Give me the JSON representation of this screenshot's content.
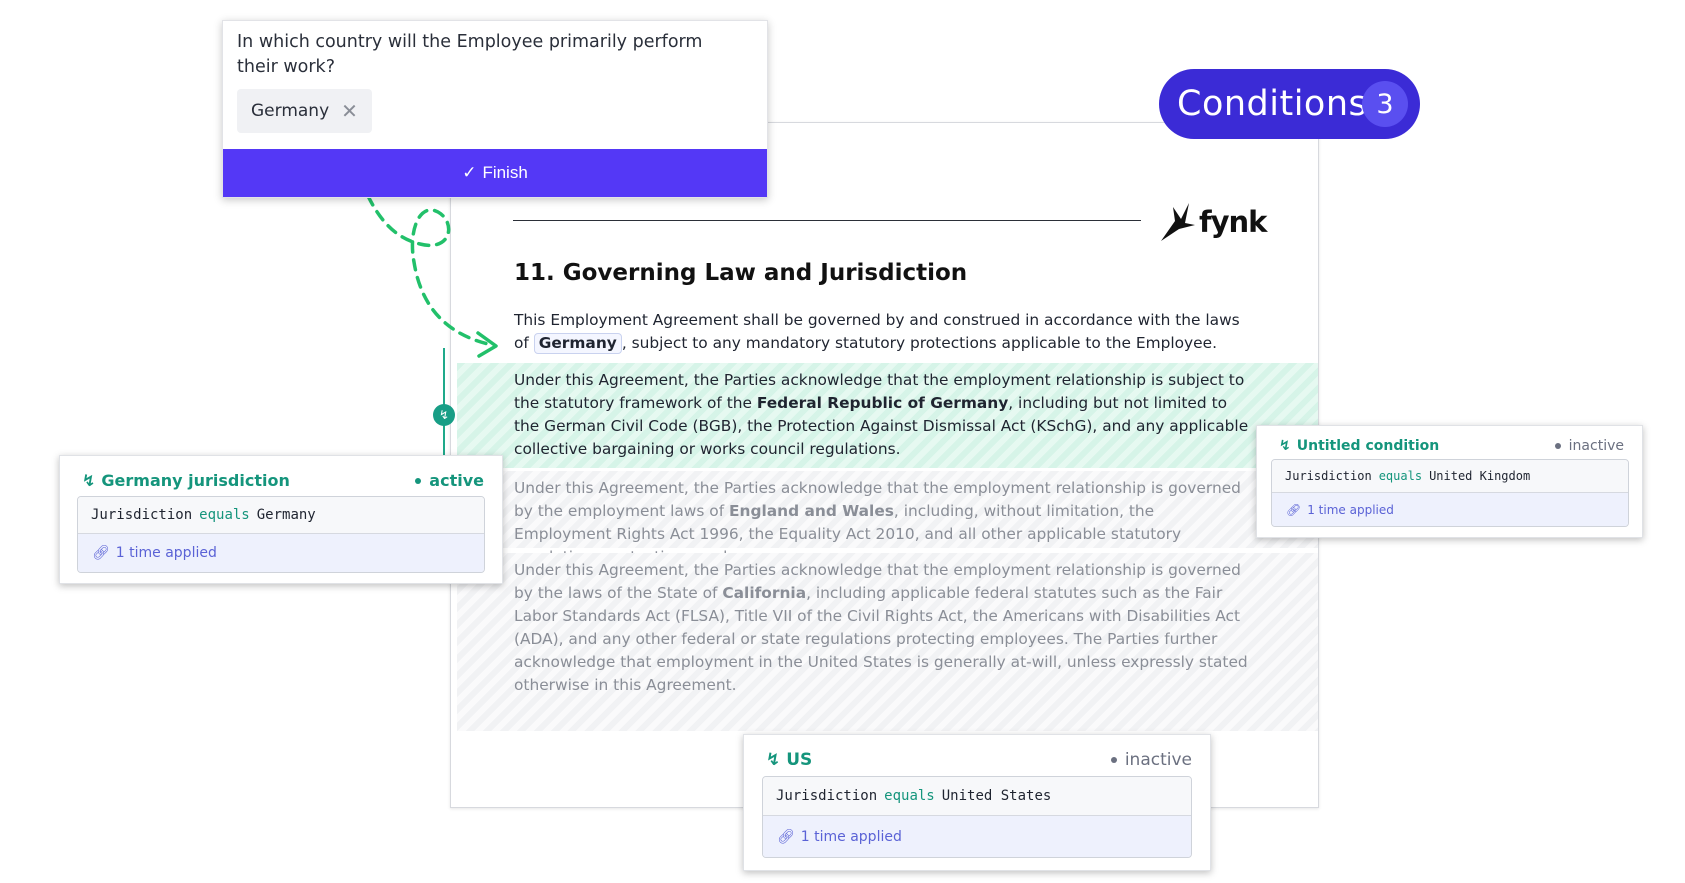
{
  "conditions": {
    "label": "Conditions",
    "count": "3"
  },
  "question": {
    "text": "In which country will the Employee primarily perform their work?",
    "selected_value": "Germany",
    "finish_label": "Finish"
  },
  "brand": {
    "logo_text": "fynk"
  },
  "document": {
    "heading": "11. Governing Law and Jurisdiction",
    "p1_before": "This Employment Agreement shall be governed by and construed in accordance with the laws of ",
    "p1_variable": "Germany",
    "p1_after": ", subject to any mandatory statutory protections applicable to the Employee.",
    "block_de": {
      "before": "Under this Agreement, the Parties acknowledge that the employment relationship is subject to the statutory framework of the ",
      "bold": "Federal Republic of Germany",
      "after": ", including but not limited to the German Civil Code (BGB), the Protection Against Dismissal Act (KSchG), and any applicable collective bargaining or works council regulations."
    },
    "block_ew": {
      "before": "Under this Agreement, the Parties acknowledge that the employment relationship is governed by the employment laws of ",
      "bold": "England and Wales",
      "after": ", including, without limitation, the Employment Rights Act 1996, the Equality Act 2010, and all other applicable statutory regulations protecting employees."
    },
    "block_ca": {
      "before": "Under this Agreement, the Parties acknowledge that the employment relationship is governed by the laws of the State of ",
      "bold": "California",
      "after": ", including applicable federal statutes such as the Fair Labor Standards Act (FLSA), Title VII of the Civil Rights Act, the Americans with Disabilities Act (ADA), and any other federal or state regulations protecting employees. The Parties further acknowledge that employment in the United States is generally at-will, unless expressly stated otherwise in this Agreement."
    }
  },
  "condition_cards": {
    "germany": {
      "title": "Germany jurisdiction",
      "status": "active",
      "field": "Jurisdiction",
      "operator": "equals",
      "value": "Germany",
      "applied": "1 time applied"
    },
    "uk": {
      "title": "Untitled condition",
      "status": "inactive",
      "field": "Jurisdiction",
      "operator": "equals",
      "value": "United Kingdom",
      "applied": "1 time applied"
    },
    "us": {
      "title": "US",
      "status": "inactive",
      "field": "Jurisdiction",
      "operator": "equals",
      "value": "United States",
      "applied": "1 time applied"
    }
  },
  "colors": {
    "accent": "#5438f6",
    "pill": "#3b2bd6",
    "green": "#15957c",
    "active_band": "#d6f4e8"
  }
}
